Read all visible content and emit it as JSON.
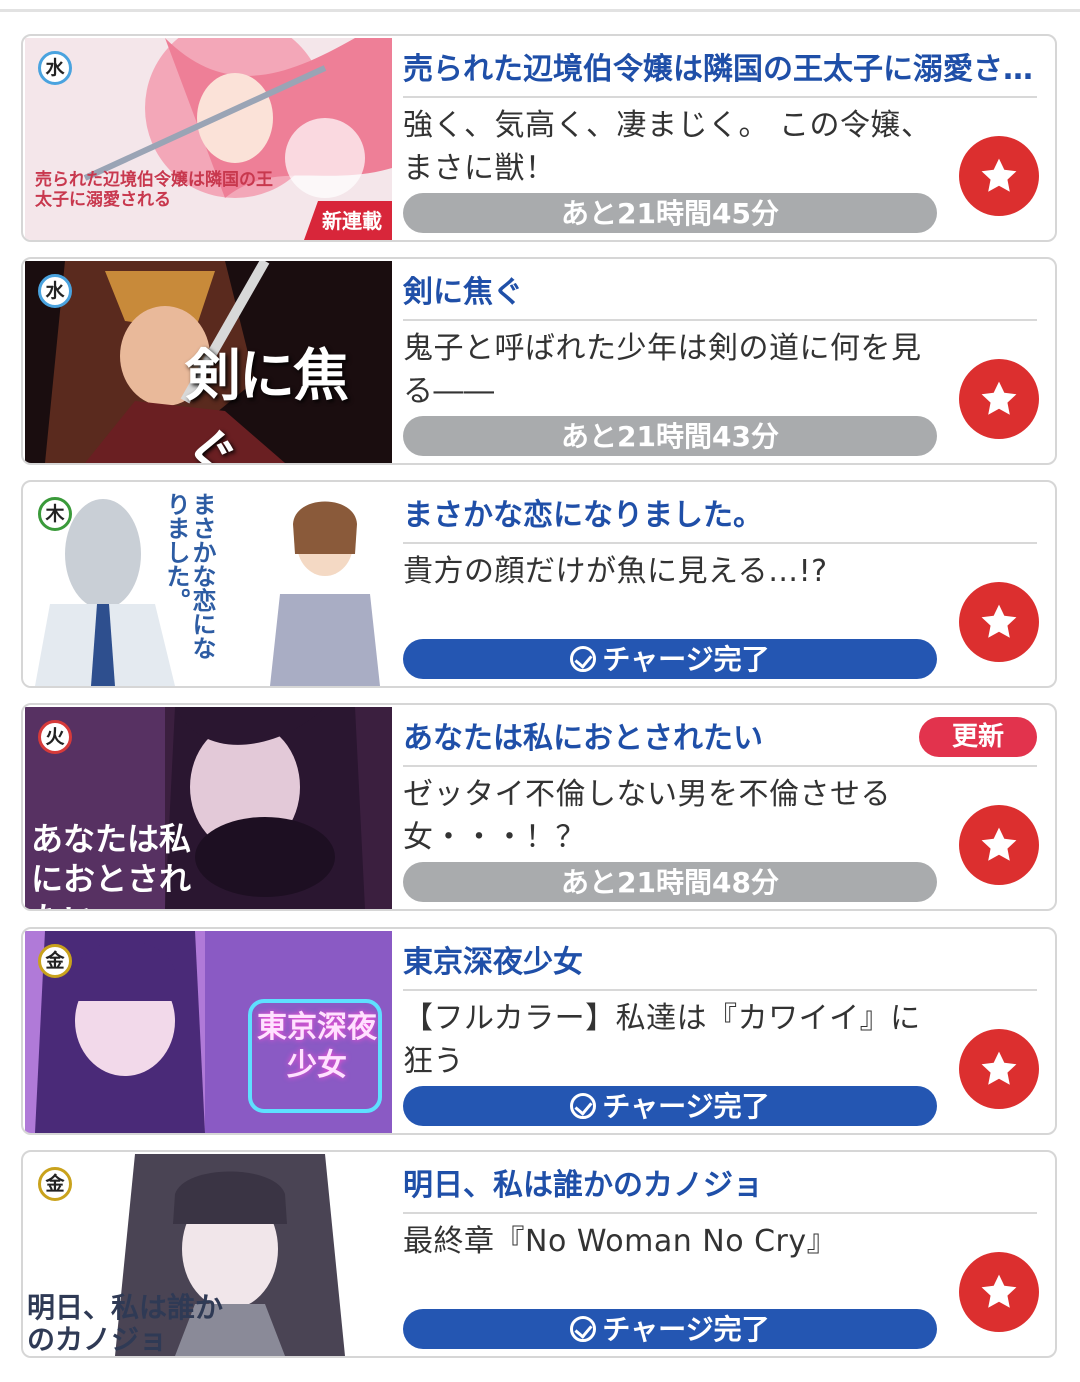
{
  "items": [
    {
      "day": "水",
      "title": "売られた辺境伯令嬢は隣国の王太子に溺愛される",
      "description": "強く、気高く、凄まじく。 この令嬢、まさに獣！",
      "status": "あと21時間45分",
      "status_kind": "countdown",
      "thumb_text": "売られた辺境伯令嬢は隣国の王太子に溺愛される",
      "thumb_badge": "新連載"
    },
    {
      "day": "水",
      "title": "剣に焦ぐ",
      "description": "鬼子と呼ばれた少年は剣の道に何を見る――",
      "status": "あと21時間43分",
      "status_kind": "countdown",
      "thumb_text": "剣に焦ぐ"
    },
    {
      "day": "木",
      "title": "まさかな恋になりました。",
      "description": "貴方の顔だけが魚に見える…!?",
      "status": "チャージ完了",
      "status_kind": "charged",
      "thumb_text": "まさかな恋になりました。"
    },
    {
      "day": "火",
      "title": "あなたは私におとされたい",
      "description": "ゼッタイ不倫しない男を不倫させる女・・・！？",
      "status": "あと21時間48分",
      "status_kind": "countdown",
      "badge": "更新",
      "thumb_text": "あなたは私におとされたい"
    },
    {
      "day": "金",
      "title": "東京深夜少女",
      "description": "【フルカラー】私達は『カワイイ』に狂う",
      "status": "チャージ完了",
      "status_kind": "charged",
      "thumb_text": "東京深夜少女"
    },
    {
      "day": "金",
      "title": "明日、私は誰かのカノジョ",
      "description": "最終章『No Woman No Cry』",
      "status": "チャージ完了",
      "status_kind": "charged",
      "thumb_text": "明日、私は誰かのカノジョ"
    }
  ],
  "colors": {
    "title": "#1f4fa8",
    "countdown_bar": "#a9abad",
    "charged_bar": "#2456b2",
    "favorite": "#dc2f2f",
    "update_badge": "#e2334d"
  },
  "icons": {
    "favorite": "star-icon",
    "charged": "check-circle-icon"
  }
}
